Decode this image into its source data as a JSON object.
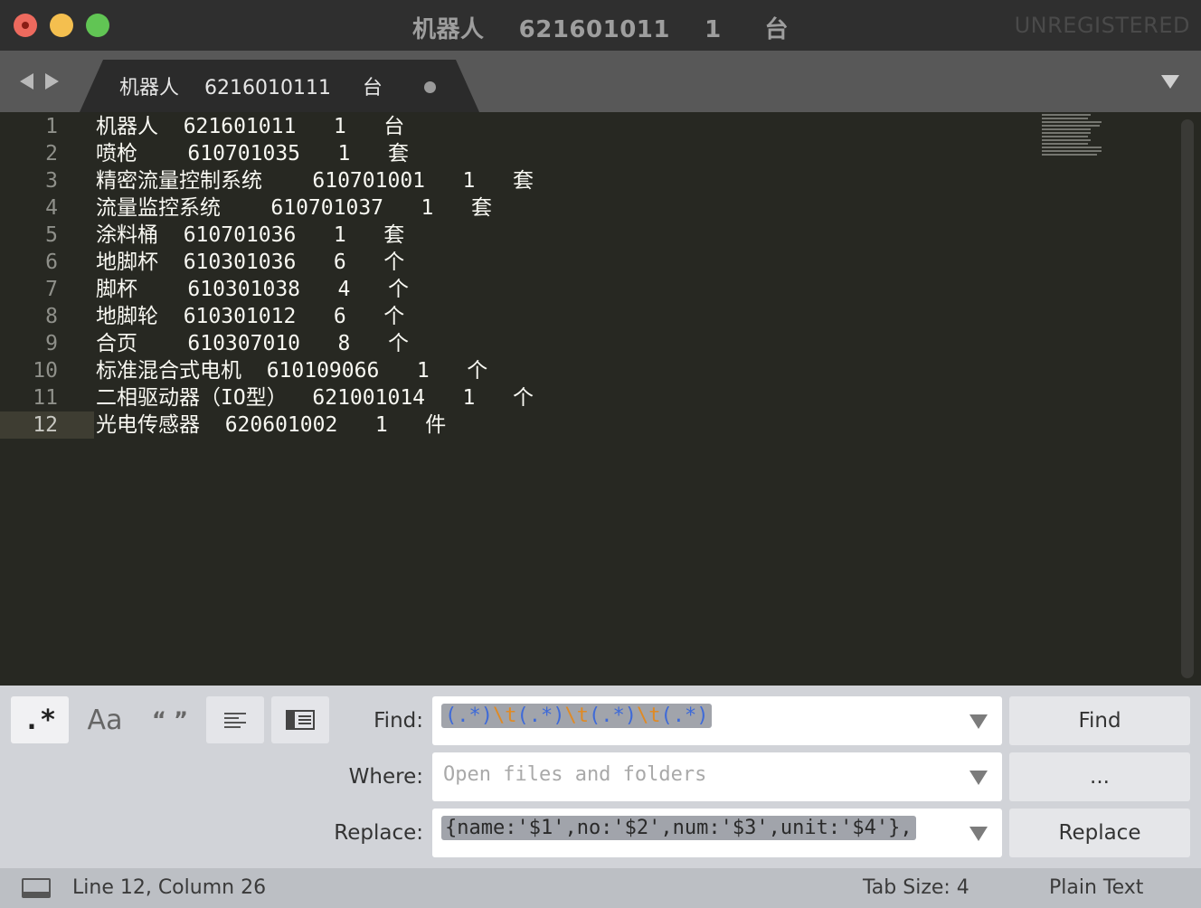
{
  "window": {
    "title": "机器人\t621601011\t1\t台",
    "title_display": "机器人    621601011    1     台",
    "license_badge": "UNREGISTERED"
  },
  "tab": {
    "label": "机器人    6216010111     台",
    "modified": true
  },
  "editor": {
    "current_line": 12,
    "lines": [
      {
        "n": "1",
        "text": "机器人\t621601011\t1\t台"
      },
      {
        "n": "2",
        "text": "喷枪\t610701035\t1\t套"
      },
      {
        "n": "3",
        "text": "精密流量控制系统\t610701001\t1\t套"
      },
      {
        "n": "4",
        "text": "流量监控系统\t610701037\t1\t套"
      },
      {
        "n": "5",
        "text": "涂料桶\t610701036\t1\t套"
      },
      {
        "n": "6",
        "text": "地脚杯\t610301036\t6\t个"
      },
      {
        "n": "7",
        "text": "脚杯\t610301038\t4\t个"
      },
      {
        "n": "8",
        "text": "地脚轮\t610301012\t6\t个"
      },
      {
        "n": "9",
        "text": "合页\t610307010\t8\t个"
      },
      {
        "n": "10",
        "text": "标准混合式电机\t610109066\t1\t个"
      },
      {
        "n": "11",
        "text": "二相驱动器（IO型）\t621001014\t1\t个"
      },
      {
        "n": "12",
        "text": "光电传感器\t620601002\t1\t件"
      }
    ]
  },
  "find_panel": {
    "options": {
      "regex": {
        "label": ".*",
        "active": true
      },
      "case": {
        "label": "Aa",
        "active": false
      },
      "whole_word": {
        "label": "“ ”",
        "active": false
      },
      "in_selection_icon": "align-left-icon",
      "highlight_icon": "sidebar-icon"
    },
    "find": {
      "label": "Find:",
      "value": "(.*)\\t(.*)\\t(.*)\\t(.*)",
      "tokens": [
        {
          "t": "(.*)",
          "c": "g"
        },
        {
          "t": "\\t",
          "c": "o"
        },
        {
          "t": "(.*)",
          "c": "g"
        },
        {
          "t": "\\t",
          "c": "o"
        },
        {
          "t": "(.*)",
          "c": "g"
        },
        {
          "t": "\\t",
          "c": "o"
        },
        {
          "t": "(.*)",
          "c": "g"
        }
      ]
    },
    "where": {
      "label": "Where:",
      "placeholder": "Open files and folders"
    },
    "replace": {
      "label": "Replace:",
      "value": "{name:'$1',no:'$2',num:'$3',unit:'$4'},"
    },
    "buttons": {
      "find": "Find",
      "where_more": "...",
      "replace": "Replace"
    }
  },
  "status": {
    "position": "Line 12, Column 26",
    "tab_size": "Tab Size: 4",
    "syntax": "Plain Text"
  },
  "colors": {
    "editor_bg": "#272822",
    "editor_fg": "#f8f8f2",
    "regex_group": "#3e6ad8",
    "regex_escape": "#e08a24"
  }
}
